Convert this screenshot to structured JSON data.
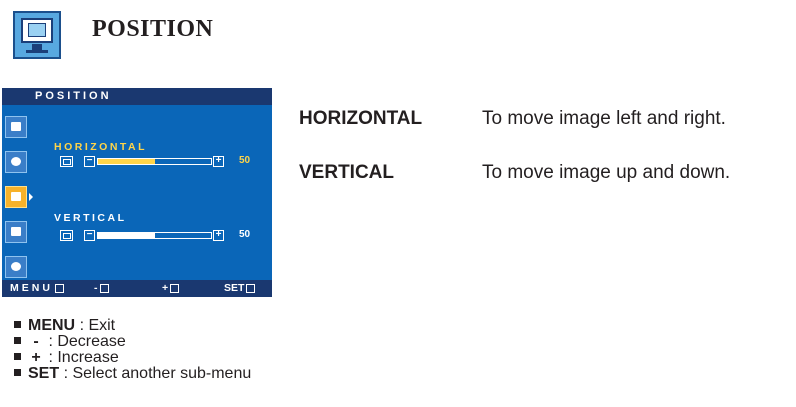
{
  "header": {
    "title": "POSITION",
    "icon": "monitor-position-icon"
  },
  "osd": {
    "title": "POSITION",
    "sidebar_icons": [
      "picture-icon",
      "color-icon",
      "position-icon",
      "setup-icon",
      "effect-icon"
    ],
    "selected_index": 2,
    "items": [
      {
        "label": "HORIZONTAL",
        "value": "50",
        "fill": 0.5,
        "selected": true
      },
      {
        "label": "VERTICAL",
        "value": "50",
        "fill": 0.5,
        "selected": false
      }
    ],
    "bottom": {
      "menu": "MENU",
      "minus": "-",
      "plus": "+",
      "set": "SET"
    },
    "colors": {
      "panel": "#0a66b8",
      "bar": "#1a3870",
      "highlight": "#ffd54a",
      "selected": "#f7b22a"
    }
  },
  "descriptions": [
    {
      "term": "HORIZONTAL",
      "text": "To move image left and right."
    },
    {
      "term": "VERTICAL",
      "text": "To move image up and down."
    }
  ],
  "legend": [
    {
      "key": "MENU",
      "text": ": Exit"
    },
    {
      "key": "-",
      "text": ": Decrease"
    },
    {
      "key": "+",
      "text": ": Increase"
    },
    {
      "key": "SET",
      "text": ": Select another sub-menu"
    }
  ]
}
